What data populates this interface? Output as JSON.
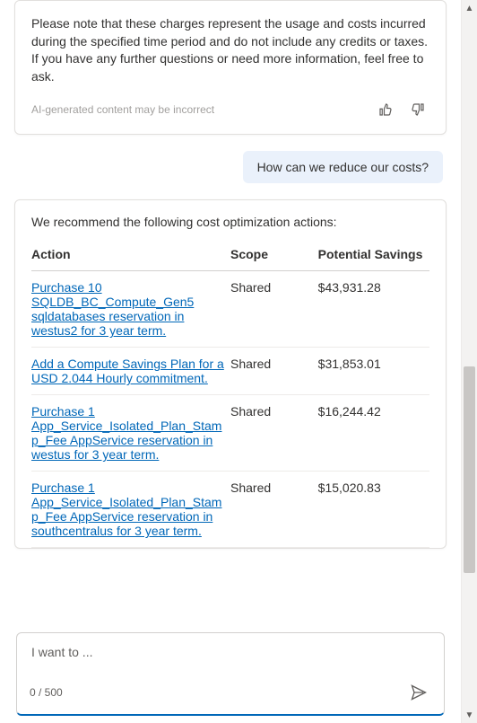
{
  "colors": {
    "link": "#0067b8",
    "user_bubble_bg": "#eaf1fb"
  },
  "prev_card": {
    "note": "Please note that these charges represent the usage and costs incurred during the specified time period and do not include any credits or taxes. If you have any further questions or need more information, feel free to ask.",
    "disclaimer": "AI-generated content may be incorrect"
  },
  "user_message": "How can we reduce our costs?",
  "reco_card": {
    "intro": "We recommend the following cost optimization actions:",
    "headers": {
      "action": "Action",
      "scope": "Scope",
      "savings": "Potential Savings"
    },
    "rows": [
      {
        "action": "Purchase 10 SQLDB_BC_Compute_Gen5 sqldatabases reservation in westus2 for 3 year term.",
        "scope": "Shared",
        "savings": "$43,931.28"
      },
      {
        "action": "Add a Compute Savings Plan for a USD 2.044 Hourly commitment.",
        "scope": "Shared",
        "savings": "$31,853.01"
      },
      {
        "action": "Purchase 1 App_Service_Isolated_Plan_Stamp_Fee AppService reservation in westus for 3 year term.",
        "scope": "Shared",
        "savings": "$16,244.42"
      },
      {
        "action": "Purchase 1 App_Service_Isolated_Plan_Stamp_Fee AppService reservation in southcentralus for 3 year term.",
        "scope": "Shared",
        "savings": "$15,020.83"
      }
    ]
  },
  "composer": {
    "placeholder": "I want to ...",
    "char_count": "0 / 500"
  }
}
